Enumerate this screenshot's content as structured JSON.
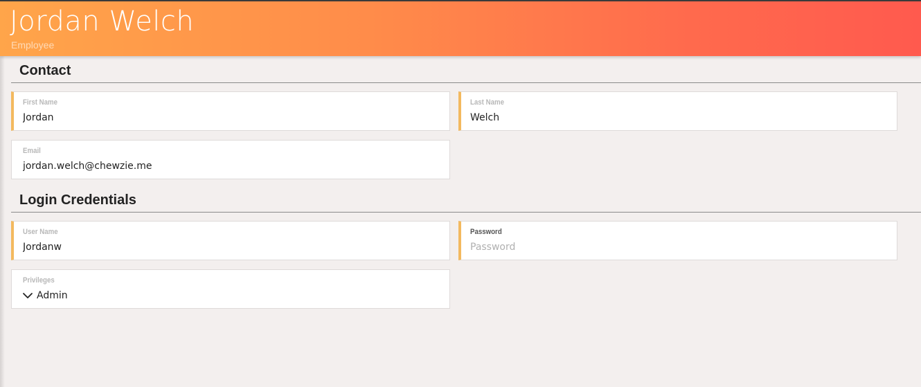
{
  "header": {
    "title": "Jordan Welch",
    "subtitle": "Employee"
  },
  "sections": {
    "contact": {
      "title": "Contact",
      "first_name": {
        "label": "First Name",
        "value": "Jordan"
      },
      "last_name": {
        "label": "Last Name",
        "value": "Welch"
      },
      "email": {
        "label": "Email",
        "value": "jordan.welch@chewzie.me"
      }
    },
    "login": {
      "title": "Login Credentials",
      "user_name": {
        "label": "User Name",
        "value": "Jordanw"
      },
      "password": {
        "label": "Password",
        "value": "",
        "placeholder": "Password"
      },
      "privileges": {
        "label": "Privileges",
        "value": "Admin",
        "icon": "chevron-down-icon"
      }
    }
  },
  "colors": {
    "header_gradient_start": "#ffa54a",
    "header_gradient_end": "#ff5a4e",
    "accent": "#f3b95f",
    "background": "#f3efee"
  }
}
